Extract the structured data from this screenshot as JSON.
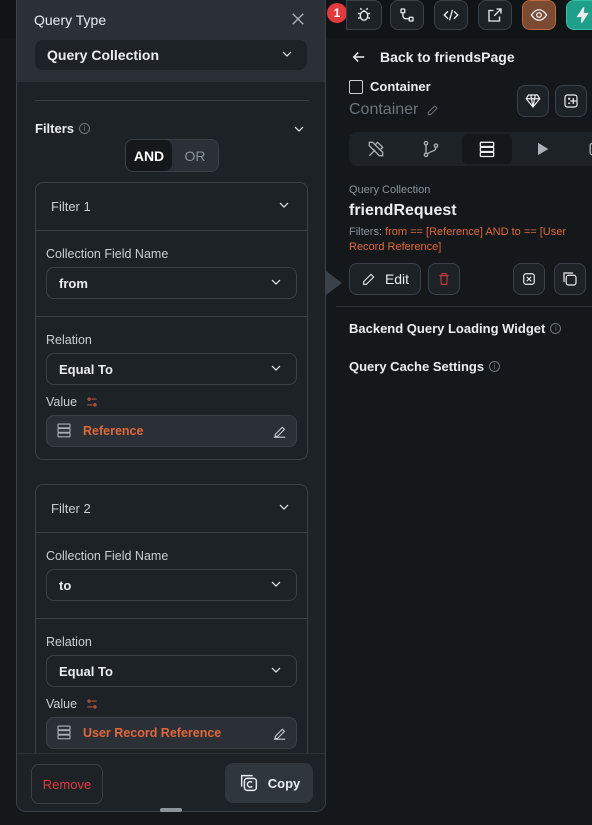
{
  "topbar": {
    "notification_count": "1"
  },
  "right_panel": {
    "back_label": "Back to friendsPage",
    "widget_type": "Container",
    "widget_name": "Container",
    "tabs": [
      "properties",
      "actions",
      "backend-query",
      "animations",
      "more"
    ],
    "query_collection_label": "Query Collection",
    "query_collection_name": "friendRequest",
    "filters_prefix": "Filters:",
    "filters_value": "from == [Reference] AND to == [User Record Reference]",
    "edit_label": "Edit",
    "backend_loading_label": "Backend Query Loading Widget",
    "cache_settings_label": "Query Cache Settings"
  },
  "query_panel": {
    "title": "Query Type",
    "query_type_value": "Query Collection",
    "filters_label": "Filters",
    "and_label": "AND",
    "or_label": "OR",
    "filters": [
      {
        "title": "Filter 1",
        "field_label": "Collection Field Name",
        "field_value": "from",
        "relation_label": "Relation",
        "relation_value": "Equal To",
        "value_label": "Value",
        "value_value": "Reference"
      },
      {
        "title": "Filter 2",
        "field_label": "Collection Field Name",
        "field_value": "to",
        "relation_label": "Relation",
        "relation_value": "Equal To",
        "value_label": "Value",
        "value_value": "User Record Reference"
      }
    ],
    "remove_label": "Remove",
    "copy_label": "Copy"
  },
  "colors": {
    "accent_orange": "#e0673b",
    "danger_red": "#e0393e",
    "teal": "#1f9e8a"
  }
}
